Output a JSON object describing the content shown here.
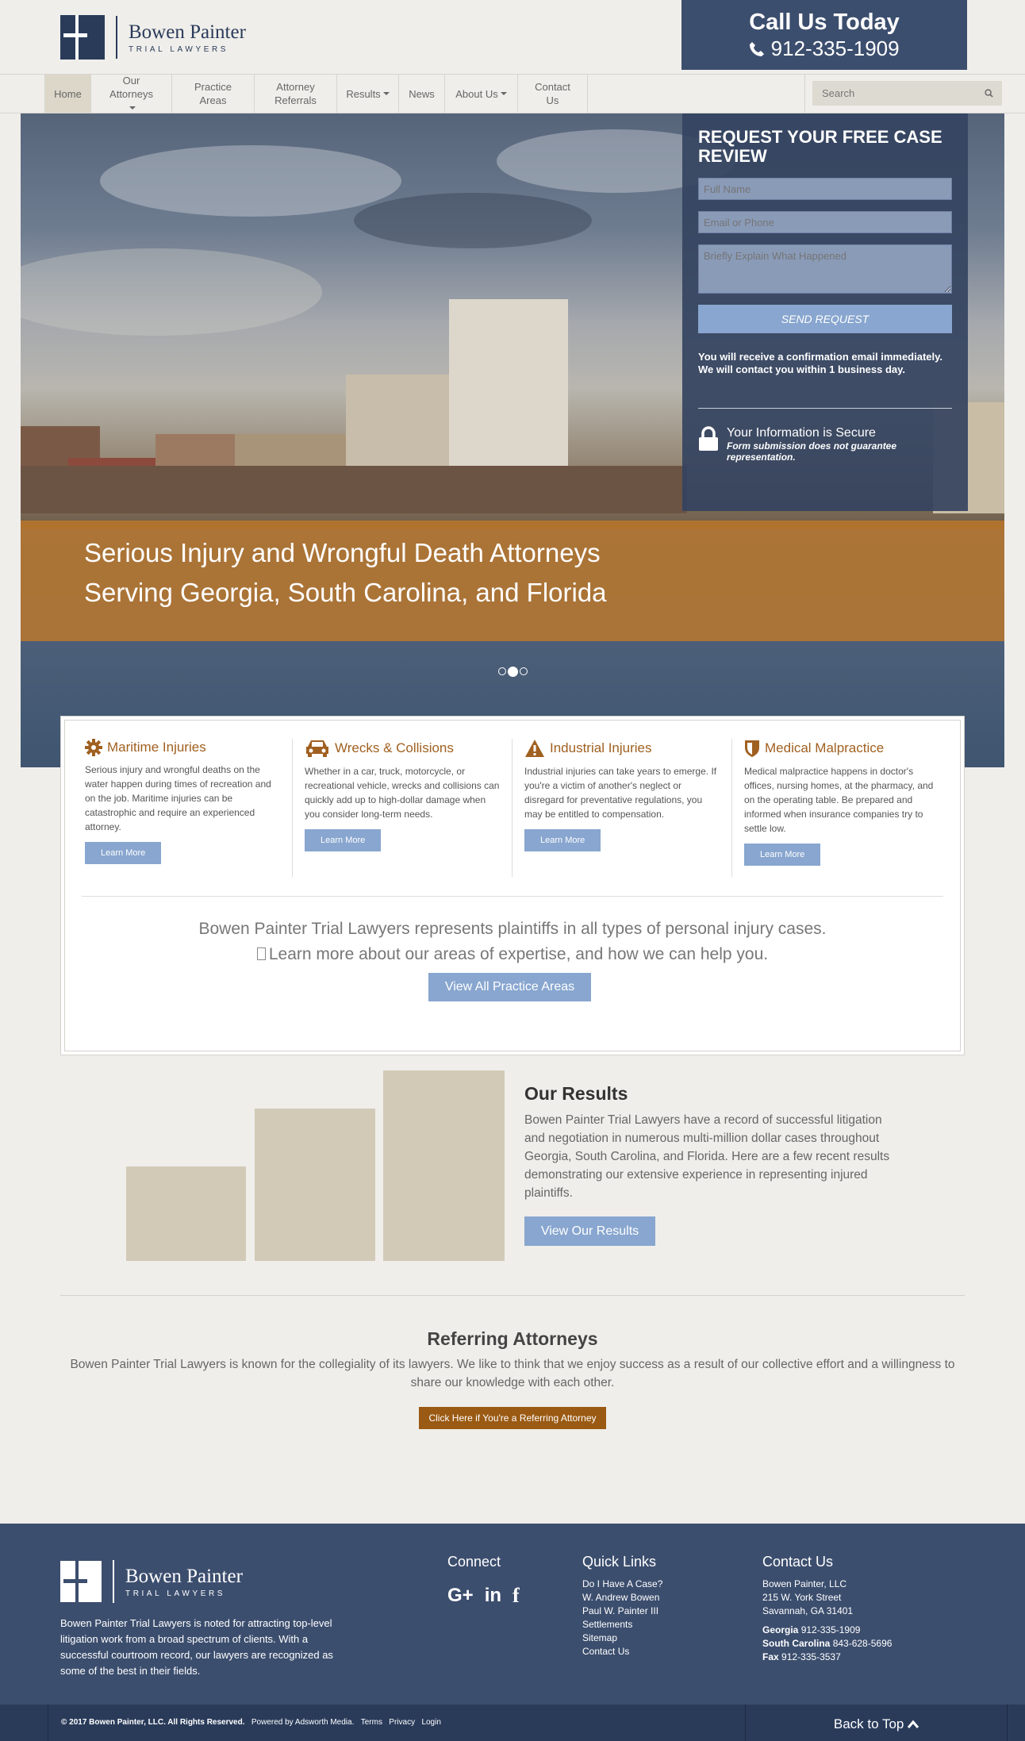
{
  "brand": {
    "name": "Bowen Painter",
    "tagline": "TRIAL LAWYERS"
  },
  "call": {
    "title": "Call Us Today",
    "phone": "912-335-1909"
  },
  "nav": {
    "items": [
      "Home",
      "Our Attorneys",
      "Practice Areas",
      "Attorney Referrals",
      "Results",
      "News",
      "About Us",
      "Contact Us"
    ],
    "search_placeholder": "Search"
  },
  "hero": {
    "line1": "Serious Injury and Wrongful Death Attorneys",
    "line2": "Serving Georgia, South Carolina, and Florida",
    "slide_count": 3,
    "active_slide": 2
  },
  "form": {
    "title": "REQUEST YOUR FREE CASE REVIEW",
    "name_placeholder": "Full Name",
    "contact_placeholder": "Email or Phone",
    "message_placeholder": "Briefly Explain What Happened",
    "submit": "SEND REQUEST",
    "confirmation": "You will receive a confirmation email immediately. We will contact you within 1 business day.",
    "secure_title": "Your Information is Secure",
    "secure_note": "Form submission does not guarantee representation."
  },
  "services": [
    {
      "title": "Maritime Injuries",
      "icon": "gear-icon",
      "text": "Serious injury and wrongful deaths on the water happen during times of recreation and on the job. Maritime injuries can be catastrophic and require an experienced attorney.",
      "button": "Learn More"
    },
    {
      "title": "Wrecks & Collisions",
      "icon": "car-icon",
      "text": "Whether in a car, truck, motorcycle, or recreational vehicle, wrecks and collisions can quickly add up to high-dollar damage when you consider long-term needs.",
      "button": "Learn More"
    },
    {
      "title": "Industrial Injuries",
      "icon": "warning-icon",
      "text": "Industrial injuries can take years to emerge. If you're a victim of another's neglect or disregard for preventative regulations, you may be entitled to compensation.",
      "button": "Learn More"
    },
    {
      "title": "Medical Malpractice",
      "icon": "shield-icon",
      "text": "Medical malpractice happens in doctor's offices, nursing homes, at the pharmacy, and on the operating table. Be prepared and informed when insurance companies try to settle low.",
      "button": "Learn More"
    }
  ],
  "practice": {
    "line1": "Bowen Painter Trial Lawyers represents plaintiffs in all types of personal injury cases.",
    "line2": "Learn more about our areas of expertise, and how we can help you.",
    "button": "View All Practice Areas"
  },
  "results": {
    "title": "Our Results",
    "text": "Bowen Painter Trial Lawyers have a record of successful litigation and negotiation in numerous multi-million dollar cases throughout Georgia, South Carolina, and Florida. Here are a few recent results demonstrating our extensive experience in representing injured plaintiffs.",
    "button": "View Our Results"
  },
  "referring": {
    "title": "Referring Attorneys",
    "text": "Bowen Painter Trial Lawyers is known for the collegiality of its lawyers. We like to think that we enjoy success as a result of our collective effort and a willingness to share our knowledge with each other.",
    "button": "Click Here if You're a Referring Attorney"
  },
  "footer": {
    "about": "Bowen Painter Trial Lawyers is noted for attracting top-level litigation work from a broad spectrum of clients. With a successful courtroom record, our lawyers are recognized as some of the best in their fields.",
    "connect_title": "Connect",
    "quick_title": "Quick Links",
    "quick_links": [
      "Do I Have A Case?",
      "W. Andrew Bowen",
      "Paul W. Painter III",
      "Settlements",
      "Sitemap",
      "Contact Us"
    ],
    "contact_title": "Contact Us",
    "address": [
      "Bowen Painter, LLC",
      "215 W. York Street",
      "Savannah, GA 31401"
    ],
    "phones": [
      {
        "label": "Georgia",
        "number": "912-335-1909"
      },
      {
        "label": "South Carolina",
        "number": "843-628-5696"
      },
      {
        "label": "Fax",
        "number": "912-335-3537"
      }
    ],
    "copyright": "© 2017 Bowen Painter, LLC. All Rights Reserved.",
    "powered": "Powered by Adsworth Media.",
    "terms": "Terms",
    "privacy": "Privacy",
    "login": "Login",
    "back_to_top": "Back to Top"
  },
  "colors": {
    "navy": "#3c4e6e",
    "accent": "#a06020",
    "button": "#88a6cf",
    "bars": "#d2cab7"
  }
}
